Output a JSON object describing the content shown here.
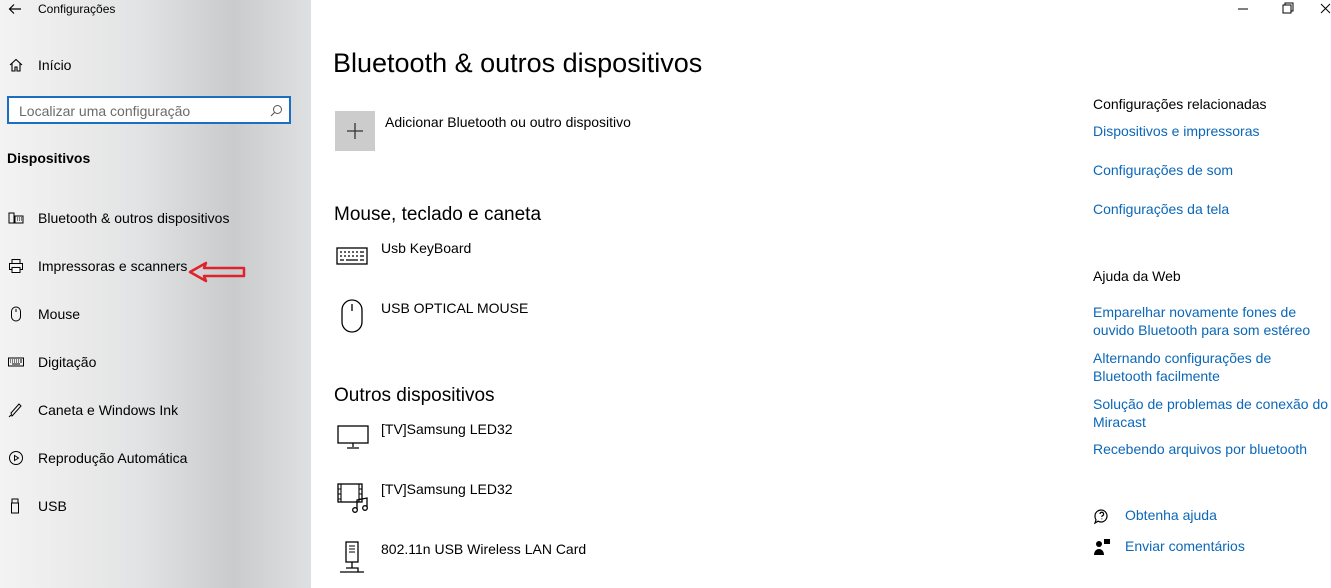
{
  "app": {
    "title": "Configurações"
  },
  "sidebar": {
    "home_label": "Início",
    "search_placeholder": "Localizar uma configuração",
    "section_title": "Dispositivos",
    "items": [
      {
        "label": "Bluetooth & outros dispositivos",
        "icon": "bluetooth-devices-icon"
      },
      {
        "label": "Impressoras e scanners",
        "icon": "printer-icon"
      },
      {
        "label": "Mouse",
        "icon": "mouse-icon"
      },
      {
        "label": "Digitação",
        "icon": "keyboard-icon"
      },
      {
        "label": "Caneta e Windows Ink",
        "icon": "pen-icon"
      },
      {
        "label": "Reprodução Automática",
        "icon": "autoplay-icon"
      },
      {
        "label": "USB",
        "icon": "usb-icon"
      }
    ]
  },
  "main": {
    "title": "Bluetooth & outros dispositivos",
    "add_device_label": "Adicionar Bluetooth ou outro dispositivo",
    "groups": [
      {
        "title": "Mouse, teclado e caneta",
        "devices": [
          {
            "name": "Usb KeyBoard",
            "icon": "keyboard-icon"
          },
          {
            "name": "USB OPTICAL MOUSE",
            "icon": "mouse-icon"
          }
        ]
      },
      {
        "title": "Outros dispositivos",
        "devices": [
          {
            "name": "[TV]Samsung LED32",
            "icon": "monitor-icon"
          },
          {
            "name": "[TV]Samsung LED32",
            "icon": "media-device-icon"
          },
          {
            "name": "802.11n USB Wireless LAN Card",
            "icon": "network-adapter-icon"
          }
        ]
      }
    ]
  },
  "related": {
    "title": "Configurações relacionadas",
    "links": [
      "Dispositivos e impressoras",
      "Configurações de som",
      "Configurações da tela"
    ]
  },
  "web_help": {
    "title": "Ajuda da Web",
    "links": [
      "Emparelhar novamente fones de ouvido Bluetooth para som estéreo",
      "Alternando configurações de Bluetooth facilmente",
      "Solução de problemas de conexão do Miracast",
      "Recebendo arquivos por bluetooth"
    ]
  },
  "support": {
    "get_help": "Obtenha ajuda",
    "feedback": "Enviar comentários"
  },
  "colors": {
    "accent": "#1b6fc2",
    "link": "#0b67b8",
    "annotation_arrow": "#e0232b"
  }
}
